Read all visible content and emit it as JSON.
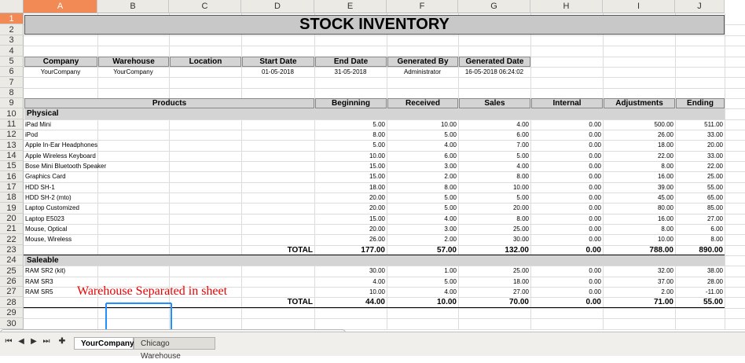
{
  "columns": [
    "A",
    "B",
    "C",
    "D",
    "E",
    "F",
    "G",
    "H",
    "I",
    "J"
  ],
  "rows": [
    "1",
    "2",
    "3",
    "4",
    "5",
    "6",
    "7",
    "8",
    "9",
    "10",
    "11",
    "12",
    "13",
    "14",
    "15",
    "16",
    "17",
    "18",
    "19",
    "20",
    "21",
    "22",
    "23",
    "24",
    "25",
    "26",
    "27",
    "28",
    "29",
    "30"
  ],
  "title": "STOCK INVENTORY",
  "meta": {
    "headers": [
      "Company",
      "Warehouse",
      "Location",
      "Start Date",
      "End Date",
      "Generated By",
      "Generated Date"
    ],
    "values": [
      "YourCompany",
      "YourCompany",
      "",
      "01-05-2018",
      "31-05-2018",
      "Administrator",
      "16-05-2018 06:24:02"
    ]
  },
  "table_headers": {
    "products": "Products",
    "beginning": "Beginning",
    "received": "Received",
    "sales": "Sales",
    "internal": "Internal",
    "adjustments": "Adjustments",
    "ending": "Ending"
  },
  "sections": [
    {
      "name": "Physical",
      "items": [
        {
          "product": "iPad Mini",
          "beginning": "5.00",
          "received": "10.00",
          "sales": "4.00",
          "internal": "0.00",
          "adjustments": "500.00",
          "ending": "511.00"
        },
        {
          "product": "iPod",
          "beginning": "8.00",
          "received": "5.00",
          "sales": "6.00",
          "internal": "0.00",
          "adjustments": "26.00",
          "ending": "33.00"
        },
        {
          "product": "Apple In-Ear Headphones",
          "beginning": "5.00",
          "received": "4.00",
          "sales": "7.00",
          "internal": "0.00",
          "adjustments": "18.00",
          "ending": "20.00"
        },
        {
          "product": "Apple Wireless Keyboard",
          "beginning": "10.00",
          "received": "6.00",
          "sales": "5.00",
          "internal": "0.00",
          "adjustments": "22.00",
          "ending": "33.00"
        },
        {
          "product": "Bose Mini Bluetooth Speaker",
          "beginning": "15.00",
          "received": "3.00",
          "sales": "4.00",
          "internal": "0.00",
          "adjustments": "8.00",
          "ending": "22.00"
        },
        {
          "product": "Graphics Card",
          "beginning": "15.00",
          "received": "2.00",
          "sales": "8.00",
          "internal": "0.00",
          "adjustments": "16.00",
          "ending": "25.00"
        },
        {
          "product": "HDD SH-1",
          "beginning": "18.00",
          "received": "8.00",
          "sales": "10.00",
          "internal": "0.00",
          "adjustments": "39.00",
          "ending": "55.00"
        },
        {
          "product": "HDD SH-2 (mto)",
          "beginning": "20.00",
          "received": "5.00",
          "sales": "5.00",
          "internal": "0.00",
          "adjustments": "45.00",
          "ending": "65.00"
        },
        {
          "product": "Laptop Customized",
          "beginning": "20.00",
          "received": "5.00",
          "sales": "20.00",
          "internal": "0.00",
          "adjustments": "80.00",
          "ending": "85.00"
        },
        {
          "product": "Laptop E5023",
          "beginning": "15.00",
          "received": "4.00",
          "sales": "8.00",
          "internal": "0.00",
          "adjustments": "16.00",
          "ending": "27.00"
        },
        {
          "product": "Mouse, Optical",
          "beginning": "20.00",
          "received": "3.00",
          "sales": "25.00",
          "internal": "0.00",
          "adjustments": "8.00",
          "ending": "6.00"
        },
        {
          "product": "Mouse, Wireless",
          "beginning": "26.00",
          "received": "2.00",
          "sales": "30.00",
          "internal": "0.00",
          "adjustments": "10.00",
          "ending": "8.00"
        }
      ],
      "total": {
        "label": "TOTAL",
        "beginning": "177.00",
        "received": "57.00",
        "sales": "132.00",
        "internal": "0.00",
        "adjustments": "788.00",
        "ending": "890.00"
      }
    },
    {
      "name": "Saleable",
      "items": [
        {
          "product": "RAM SR2 (kit)",
          "beginning": "30.00",
          "received": "1.00",
          "sales": "25.00",
          "internal": "0.00",
          "adjustments": "32.00",
          "ending": "38.00"
        },
        {
          "product": "RAM SR3",
          "beginning": "4.00",
          "received": "5.00",
          "sales": "18.00",
          "internal": "0.00",
          "adjustments": "37.00",
          "ending": "28.00"
        },
        {
          "product": "RAM SR5",
          "beginning": "10.00",
          "received": "4.00",
          "sales": "27.00",
          "internal": "0.00",
          "adjustments": "2.00",
          "ending": "-11.00"
        }
      ],
      "total": {
        "label": "TOTAL",
        "beginning": "44.00",
        "received": "10.00",
        "sales": "70.00",
        "internal": "0.00",
        "adjustments": "71.00",
        "ending": "55.00"
      }
    }
  ],
  "annotation": "Warehouse Separated in sheet",
  "tabs": [
    {
      "label": "YourCompany",
      "active": true
    },
    {
      "label": "Chicago Warehouse",
      "active": false
    }
  ],
  "nav_icons": [
    "first-sheet-icon",
    "prev-sheet-icon",
    "next-sheet-icon",
    "last-sheet-icon",
    "add-sheet-icon"
  ],
  "colors": {
    "selected_header": "#f28a56",
    "section_fill": "#d4d4d4",
    "annotation": "#e00000",
    "arrow": "#1e90ff"
  }
}
